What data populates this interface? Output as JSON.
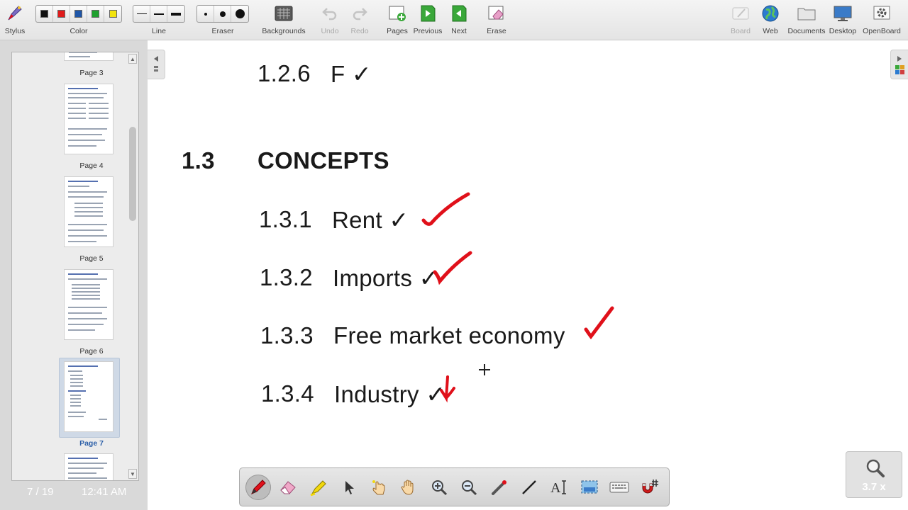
{
  "toolbar": {
    "stylus": "Stylus",
    "color": "Color",
    "line": "Line",
    "eraser": "Eraser",
    "backgrounds": "Backgrounds",
    "undo": "Undo",
    "redo": "Redo",
    "pages": "Pages",
    "previous": "Previous",
    "next": "Next",
    "erase": "Erase",
    "board": "Board",
    "web": "Web",
    "documents": "Documents",
    "desktop": "Desktop",
    "openboard": "OpenBoard",
    "colors": [
      "#111111",
      "#e01b1b",
      "#1f56a8",
      "#1fa02f",
      "#f2e30c"
    ]
  },
  "thumbnails": {
    "pages": [
      {
        "label": "Page 3"
      },
      {
        "label": "Page 4"
      },
      {
        "label": "Page 5"
      },
      {
        "label": "Page 6"
      },
      {
        "label": "Page 7",
        "active": true
      }
    ]
  },
  "status": {
    "page_counter": "7 / 19",
    "clock": "12:41 AM"
  },
  "document": {
    "line_126_num": "1.2.6",
    "line_126_text": "F ✓",
    "section_num": "1.3",
    "section_title": "CONCEPTS",
    "items": [
      {
        "num": "1.3.1",
        "text": "Rent ✓"
      },
      {
        "num": "1.3.2",
        "text": "Imports ✓"
      },
      {
        "num": "1.3.3",
        "text": "Free market economy"
      },
      {
        "num": "1.3.4",
        "text": "Industry ✓"
      }
    ],
    "ink_color": "#e0101a"
  },
  "zoom": {
    "value": "3.7 x"
  }
}
